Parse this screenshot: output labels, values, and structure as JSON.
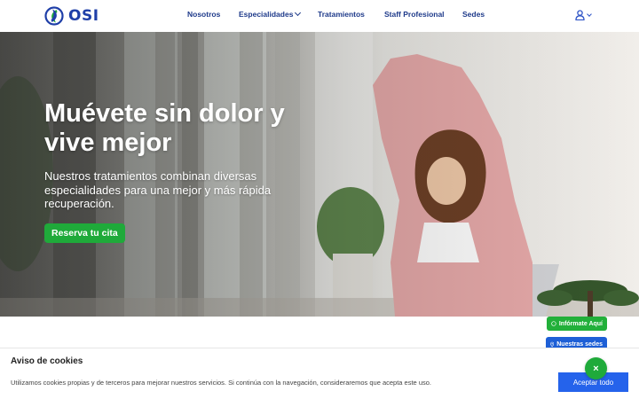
{
  "brand": {
    "name": "OSI",
    "color": "#1f3fa8",
    "accent": "#1faa3a"
  },
  "nav": {
    "items": [
      {
        "label": "Nosotros"
      },
      {
        "label": "Especialidades",
        "has_dropdown": true
      },
      {
        "label": "Tratamientos"
      },
      {
        "label": "Staff Profesional"
      },
      {
        "label": "Sedes"
      }
    ],
    "user_icon": "user-icon"
  },
  "hero": {
    "title": "Muévete sin dolor y vive mejor",
    "subtitle": "Nuestros tratamientos combinan diversas especialidades para una mejor y más rápida recuperación.",
    "cta_label": "Reserva tu cita"
  },
  "floating": {
    "whatsapp_label": "Infórmate Aquí",
    "whatsapp_icon": "whatsapp-icon",
    "sedes_label": "Nuestras sedes",
    "sedes_icon": "map-pin-icon"
  },
  "cookie": {
    "title": "Aviso de cookies",
    "text": "Utilizamos cookies propias y de terceros para mejorar nuestros servicios. Si continúa con la navegación, consideraremos que acepta este uso.",
    "accept_label": "Aceptar todo",
    "close_label": "×"
  }
}
